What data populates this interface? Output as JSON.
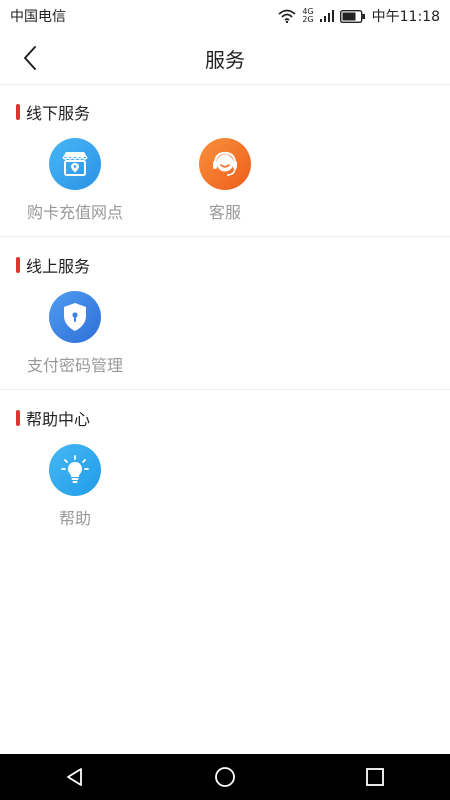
{
  "status_bar": {
    "carrier": "中国电信",
    "network_top": "4G",
    "network_bottom": "2G",
    "time": "中午11:18"
  },
  "header": {
    "title": "服务",
    "back_icon": "back-chevron-icon"
  },
  "sections": [
    {
      "title": "线下服务",
      "items": [
        {
          "label": "购卡充值网点",
          "icon": "store-location-icon",
          "color": "#3aa6ee"
        },
        {
          "label": "客服",
          "icon": "headset-icon",
          "color": "#f26c24"
        }
      ]
    },
    {
      "title": "线上服务",
      "items": [
        {
          "label": "支付密码管理",
          "icon": "shield-lock-icon",
          "color": "#3b82e4"
        }
      ]
    },
    {
      "title": "帮助中心",
      "items": [
        {
          "label": "帮助",
          "icon": "lightbulb-icon",
          "color": "#2fa9ee"
        }
      ]
    }
  ],
  "colors": {
    "accent": "#e0322f",
    "label": "#999999"
  },
  "nav": {
    "back": "triangle-back-icon",
    "home": "circle-home-icon",
    "recents": "square-recents-icon"
  }
}
